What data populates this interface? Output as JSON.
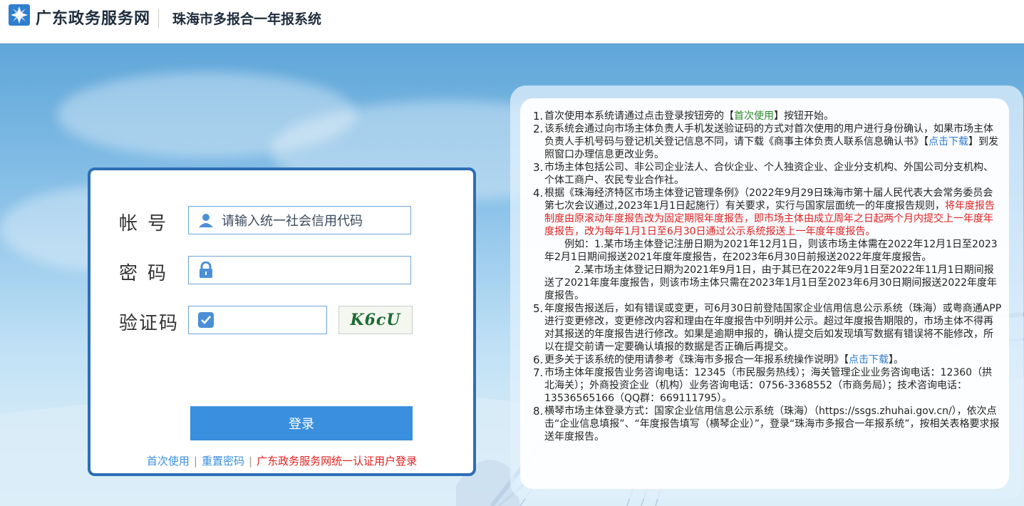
{
  "header": {
    "brand": "广东政务服务网",
    "system_title": "珠海市多报合一年报系统"
  },
  "login": {
    "account_label": "帐号",
    "account_placeholder": "请输入统一社会信用代码",
    "password_label": "密码",
    "captcha_label": "验证码",
    "captcha_text": "K6cU",
    "login_button": "登录",
    "links": {
      "first_use": "首次使用",
      "reset_password": "重置密码",
      "unified_login": "广东政务服务网统一认证用户登录"
    },
    "colors": {
      "border": "#2d6fb3",
      "button": "#3a8fde",
      "link_red": "#e02020"
    }
  },
  "notice": {
    "item1": {
      "num": "1.",
      "a": "首次使用本系统请通过点击登录按钮旁的【",
      "link": "首次使用",
      "b": "】按钮开始。"
    },
    "item2": {
      "num": "2.",
      "a": "该系统会通过向市场主体负责人手机发送验证码的方式对首次使用的用户进行身份确认，如果市场主体负责人手机号码与登记机关登记信息不同，请下载《商事主体负责人联系信息确认书》【",
      "link": "点击下载",
      "b": "】到发照窗口办理信息更改业务。"
    },
    "item3": {
      "num": "3.",
      "text": "市场主体包括公司、非公司企业法人、合伙企业、个人独资企业、企业分支机构、外国公司分支机构、个体工商户、农民专业合作社。"
    },
    "item4": {
      "num": "4.",
      "a": "根据《珠海经济特区市场主体登记管理条例》（2022年9月29日珠海市第十届人民代表大会常务委员会第七次会议通过,2023年1月1日起施行）有关要求，实行与国家层面统一的年度报告规则，",
      "red": "将年度报告制度由原滚动年度报告改为固定期限年度报告，即市场主体由成立周年之日起两个月内提交上一年度年度报告，改为每年1月1日至6月30日通过公示系统报送上一年度年度报告。",
      "example1": "例如：1.某市场主体登记注册日期为2021年12月1日，则该市场主体需在2022年12月1日至2023年2月1日期间报送2021年度年度报告，在2023年6月30日前报送2022年度年度报告。",
      "example2": "2.某市场主体登记日期为2021年9月1日，由于其已在2022年9月1日至2022年11月1日期间报送了2021年度年度报告，则该市场主体只需在2023年1月1日至2023年6月30日期间报送2022年度年度报告。"
    },
    "item5": {
      "num": "5.",
      "text": "年度报告报送后，如有错误或变更，可6月30日前登陆国家企业信用信息公示系统（珠海）或粤商通APP进行变更修改，变更修改内容和理由在年度报告中列明并公示。超过年度报告期限的，市场主体不得再对其报送的年度报告进行修改。如果是逾期申报的，确认提交后如发现填写数据有错误将不能修改，所以在提交前请一定要确认填报的数据是否正确后再提交。"
    },
    "item6": {
      "num": "6.",
      "a": "更多关于该系统的使用请参考《珠海市多报合一年报系统操作说明》【",
      "link": "点击下载",
      "b": "】。"
    },
    "item7": {
      "num": "7.",
      "text": "市场主体年度报告业务咨询电话：12345（市民服务热线）；海关管理企业业务咨询电话：12360（拱北海关）；外商投资企业（机构）业务咨询电话：0756-3368552（市商务局）；技术咨询电话：13536565166（QQ群：669111795）。"
    },
    "item8": {
      "num": "8.",
      "text": "横琴市场主体登录方式：国家企业信用信息公示系统（珠海）（https://ssgs.zhuhai.gov.cn/），依次点击“企业信息填报”、“年度报告填写（横琴企业）”，登录“珠海市多报合一年报系统”，按相关表格要求报送年度报告。"
    }
  }
}
